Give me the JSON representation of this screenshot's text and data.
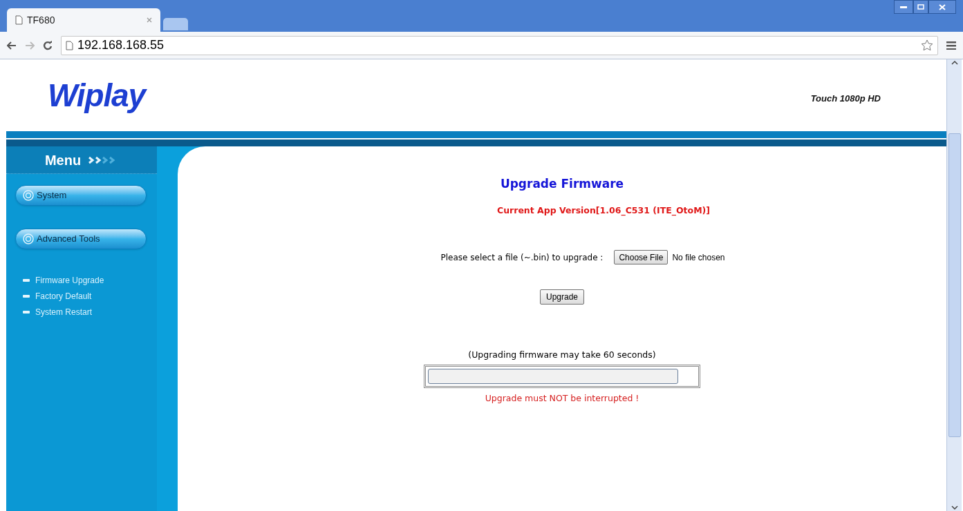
{
  "browser": {
    "tab_title": "TF680",
    "address": "192.168.168.55"
  },
  "header": {
    "logo": "Wiplay",
    "model": "Touch 1080p HD"
  },
  "sidebar": {
    "title": "Menu",
    "sections": [
      {
        "label": "System"
      },
      {
        "label": "Advanced Tools"
      }
    ],
    "items": [
      {
        "label": "Firmware Upgrade"
      },
      {
        "label": "Factory Default"
      },
      {
        "label": "System Restart"
      }
    ]
  },
  "main": {
    "title": "Upgrade Firmware",
    "version": "Current App Version[1.06_C531 (ITE_OtoM)]",
    "file_prompt": "Please select a file (~.bin) to upgrade :",
    "choose_button": "Choose File",
    "file_status": "No file chosen",
    "upgrade_button": "Upgrade",
    "note": "(Upgrading firmware may take 60 seconds)",
    "warning": "Upgrade must NOT be interrupted !"
  }
}
